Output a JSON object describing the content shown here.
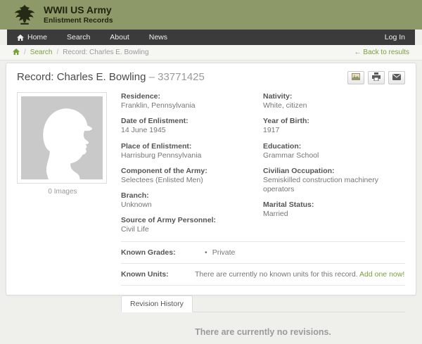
{
  "site": {
    "title": "WWII US Army",
    "subtitle": "Enlistment Records"
  },
  "nav": {
    "home": "Home",
    "search": "Search",
    "about": "About",
    "news": "News",
    "login": "Log In"
  },
  "breadcrumb": {
    "separator": "/",
    "search": "Search",
    "current": "Record: Charles E. Bowling",
    "back": "← Back to results"
  },
  "record": {
    "title": "Record: Charles E. Bowling",
    "serial": "– 33771425",
    "portrait_caption": "0 Images",
    "fields_left": [
      {
        "label": "Residence:",
        "value": "Franklin, Pennsylvania"
      },
      {
        "label": "Date of Enlistment:",
        "value": "14 June 1945"
      },
      {
        "label": "Place of Enlistment:",
        "value": "Harrisburg Pennsylvania"
      },
      {
        "label": "Component of the Army:",
        "value": "Selectees (Enlisted Men)"
      },
      {
        "label": "Branch:",
        "value": "Unknown"
      },
      {
        "label": "Source of Army Personnel:",
        "value": "Civil Life"
      }
    ],
    "fields_right": [
      {
        "label": "Nativity:",
        "value": "White, citizen"
      },
      {
        "label": "Year of Birth:",
        "value": "1917"
      },
      {
        "label": "Education:",
        "value": "Grammar School"
      },
      {
        "label": "Civilian Occupation:",
        "value": "Semiskilled construction machinery operators"
      },
      {
        "label": "Marital Status:",
        "value": "Married"
      }
    ],
    "known_grades_label": "Known Grades:",
    "known_grades": [
      "Private"
    ],
    "known_units_label": "Known Units:",
    "known_units_text": "There are currently no known units for this record.",
    "known_units_link": "Add one now!",
    "tab_label": "Revision History",
    "no_revisions": "There are currently no revisions."
  },
  "icons": {
    "logo": "army-seal-icon",
    "home": "home-icon",
    "photos": "photos-icon",
    "print": "print-icon",
    "email": "email-icon",
    "soldier": "soldier-silhouette-icon"
  },
  "colors": {
    "header_olive": "#8d9968",
    "nav_dark": "#3b3b3b",
    "link_green": "#7aa03e",
    "page_bg": "#efefec",
    "card_border": "#dcdcda",
    "label_text": "#555555",
    "value_text": "#767676",
    "muted_text": "#9b9b9b"
  }
}
